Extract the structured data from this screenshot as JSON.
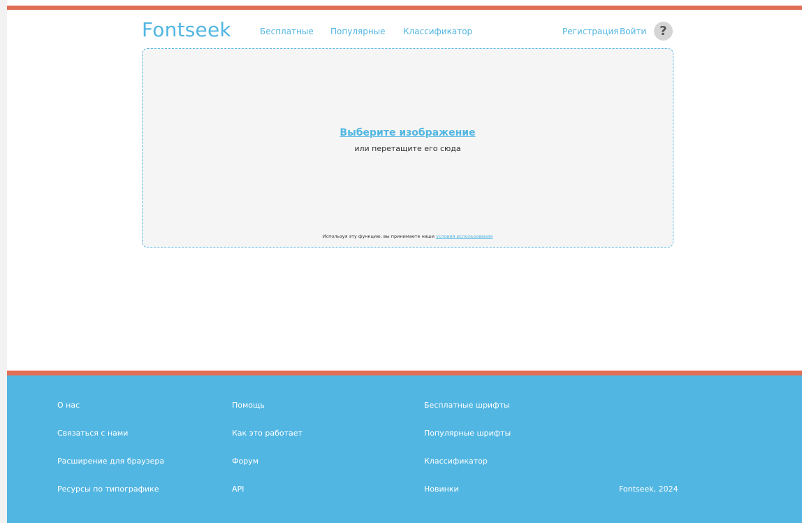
{
  "header": {
    "logo": "Fontseek",
    "nav": {
      "free": "Бесплатные",
      "popular": "Популярные",
      "classifier": "Классификатор"
    },
    "register": "Регистрация",
    "login": "Войти",
    "help": "?"
  },
  "dropzone": {
    "choose": "Выберите изображение",
    "drag_hint": "или перетащите его сюда",
    "terms_prefix": "Используя эту функцию, вы принимаете наши",
    "terms_link": "условия использования"
  },
  "footer": {
    "col1": [
      "О нас",
      "Связаться с нами",
      "Расширение для браузера",
      "Ресурсы по типографике"
    ],
    "col2": [
      "Помощь",
      "Как это работает",
      "Форум",
      "API"
    ],
    "col3": [
      "Бесплатные шрифты",
      "Популярные шрифты",
      "Классификатор",
      "Новинки"
    ],
    "copyright": "Fontseek, 2024"
  },
  "colors": {
    "accent": "#52b6e2",
    "stripe": "#e06d55",
    "dropzone_bg": "#f5f5f5"
  }
}
